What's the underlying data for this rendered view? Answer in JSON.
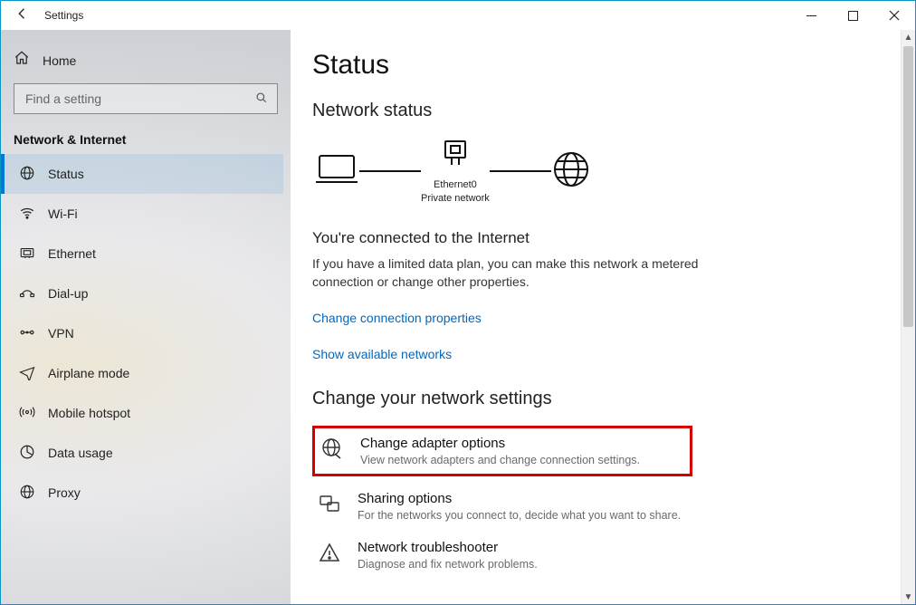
{
  "window": {
    "title": "Settings"
  },
  "sidebar": {
    "home": "Home",
    "search_placeholder": "Find a setting",
    "section": "Network & Internet",
    "items": [
      {
        "label": "Status"
      },
      {
        "label": "Wi-Fi"
      },
      {
        "label": "Ethernet"
      },
      {
        "label": "Dial-up"
      },
      {
        "label": "VPN"
      },
      {
        "label": "Airplane mode"
      },
      {
        "label": "Mobile hotspot"
      },
      {
        "label": "Data usage"
      },
      {
        "label": "Proxy"
      }
    ]
  },
  "page": {
    "title": "Status",
    "subtitle": "Network status",
    "diagram": {
      "adapter": "Ethernet0",
      "network_type": "Private network"
    },
    "connected_title": "You're connected to the Internet",
    "connected_body": "If you have a limited data plan, you can make this network a metered connection or change other properties.",
    "link_change_props": "Change connection properties",
    "link_show_networks": "Show available networks",
    "change_heading": "Change your network settings",
    "rows": [
      {
        "title": "Change adapter options",
        "desc": "View network adapters and change connection settings."
      },
      {
        "title": "Sharing options",
        "desc": "For the networks you connect to, decide what you want to share."
      },
      {
        "title": "Network troubleshooter",
        "desc": "Diagnose and fix network problems."
      }
    ]
  }
}
